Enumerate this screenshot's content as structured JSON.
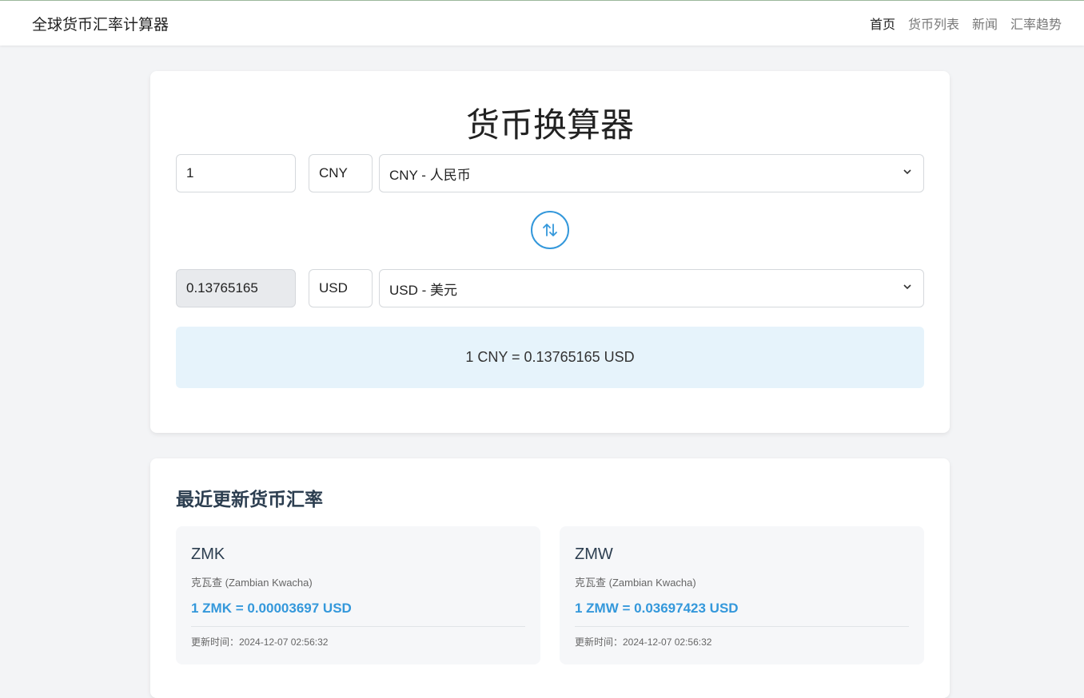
{
  "navbar": {
    "brand": "全球货币汇率计算器",
    "links": [
      "首页",
      "货币列表",
      "新闻",
      "汇率趋势"
    ]
  },
  "converter": {
    "title": "货币换算器",
    "from": {
      "amount": "1",
      "code": "CNY",
      "select": "CNY - 人民币"
    },
    "to": {
      "amount": "0.13765165",
      "code": "USD",
      "select": "USD - 美元"
    },
    "swap_icon": "swap-arrows-icon",
    "result": "1 CNY = 0.13765165 USD"
  },
  "recent": {
    "title": "最近更新货币汇率",
    "cards": [
      {
        "code": "ZMK",
        "name": "克瓦查 (Zambian Kwacha)",
        "rate": "1 ZMK = 0.00003697 USD",
        "updated": "更新时间：2024-12-07 02:56:32"
      },
      {
        "code": "ZMW",
        "name": "克瓦查 (Zambian Kwacha)",
        "rate": "1 ZMW = 0.03697423 USD",
        "updated": "更新时间：2024-12-07 02:56:32"
      }
    ]
  },
  "colors": {
    "accent": "#3498db",
    "result_bg": "#e6f3fb",
    "page_bg": "#f3f4f6",
    "heading": "#2c3e50"
  }
}
